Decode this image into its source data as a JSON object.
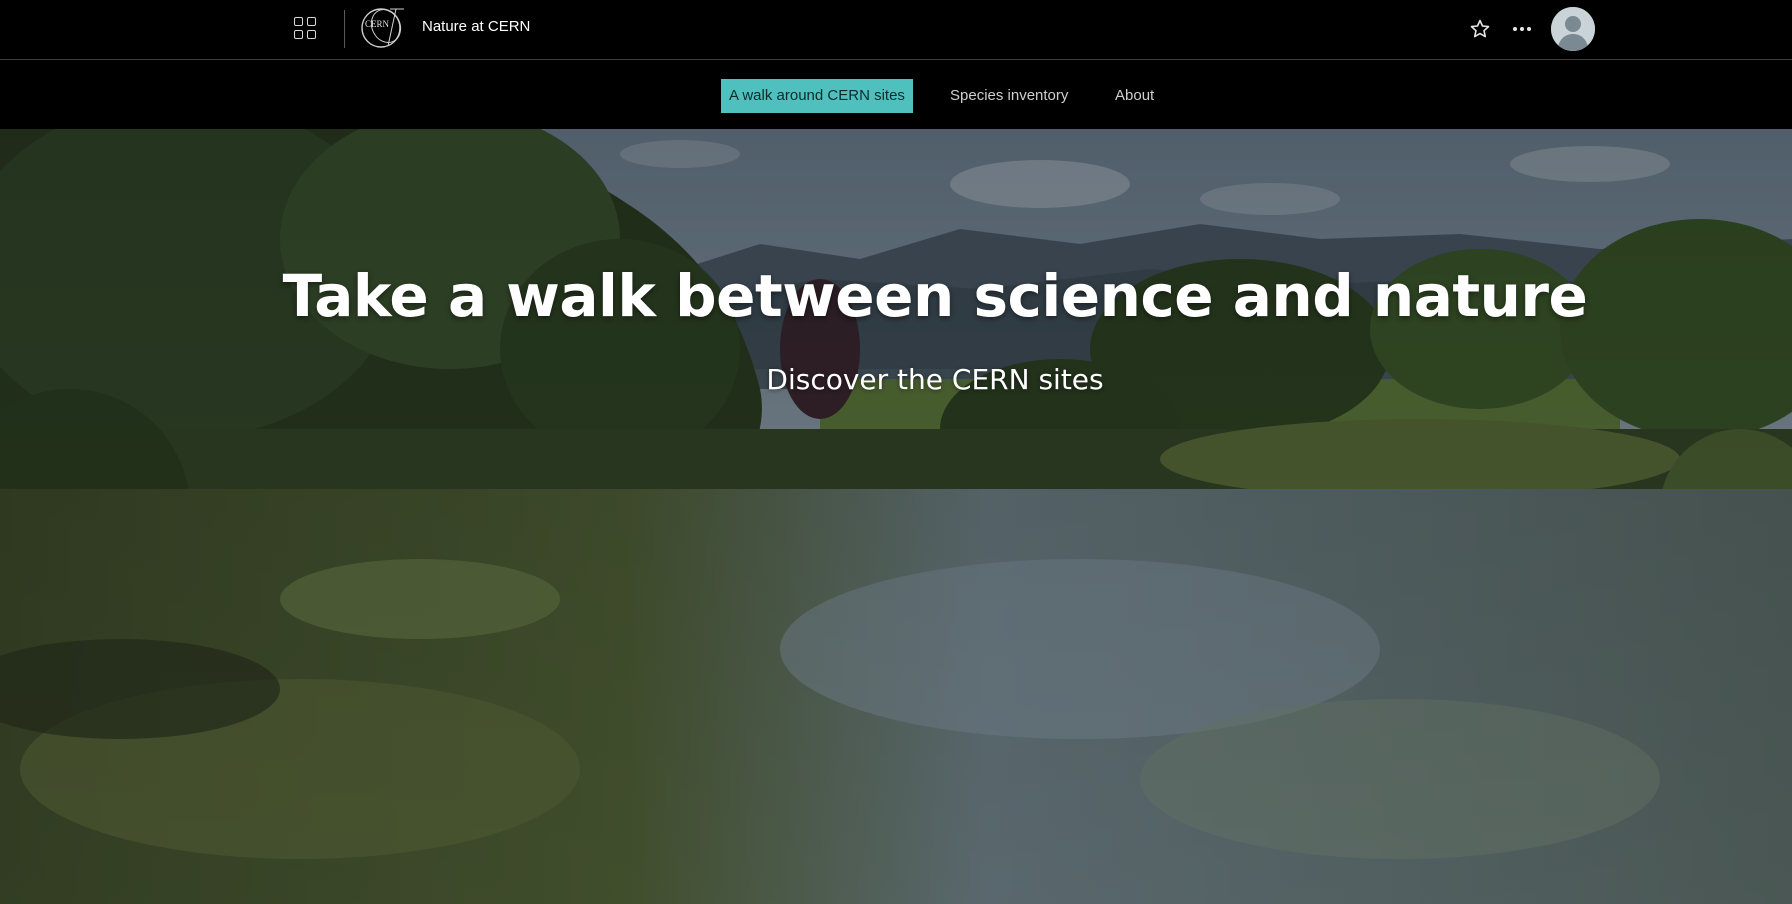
{
  "header": {
    "site_title": "Nature at CERN",
    "logo_text": "CERN",
    "icons": {
      "app_launcher": "grid-icon",
      "favorite": "star-icon",
      "more": "ellipsis-icon",
      "user": "avatar-icon"
    }
  },
  "nav": {
    "items": [
      {
        "label": "A walk around CERN sites",
        "active": true
      },
      {
        "label": "Species inventory",
        "active": false
      },
      {
        "label": "About",
        "active": false
      }
    ]
  },
  "hero": {
    "title": "Take a walk between science and nature",
    "subtitle": "Discover the CERN sites"
  },
  "colors": {
    "background": "#000000",
    "accent": "#4fc0bd",
    "nav_text": "#cfcfcf",
    "title_text": "#ffffff"
  }
}
